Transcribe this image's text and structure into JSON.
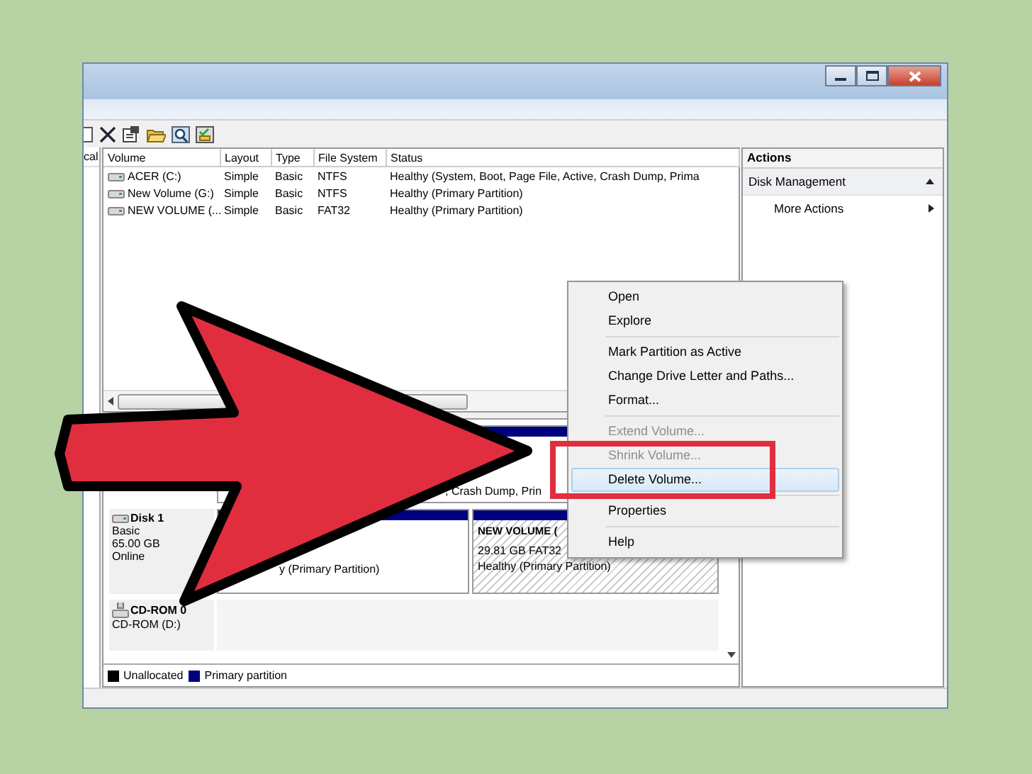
{
  "navigation_pane": {
    "header": "cal"
  },
  "volume_table": {
    "columns": [
      "Volume",
      "Layout",
      "Type",
      "File System",
      "Status"
    ],
    "rows": [
      {
        "cells": [
          "ACER (C:)",
          "Simple",
          "Basic",
          "NTFS",
          "Healthy (System, Boot, Page File, Active, Crash Dump, Prima"
        ]
      },
      {
        "cells": [
          "New Volume (G:)",
          "Simple",
          "Basic",
          "NTFS",
          "Healthy (Primary Partition)"
        ]
      },
      {
        "cells": [
          "NEW VOLUME (...",
          "Simple",
          "Basic",
          "FAT32",
          "Healthy (Primary Partition)"
        ]
      }
    ]
  },
  "disk_pane": {
    "disks": [
      {
        "kind": "covered",
        "partitions": [
          {
            "status": ", Crash Dump, Prin",
            "selected": false
          }
        ]
      },
      {
        "kind": "disk",
        "name": "Disk 1",
        "type": "Basic",
        "size": "65.00 GB",
        "state": "Online",
        "partitions": [
          {
            "status": "y (Primary Partition)",
            "selected": false
          },
          {
            "name": "NEW VOLUME (",
            "size": "29.81 GB FAT32",
            "status": "Healthy (Primary Partition)",
            "selected": true
          }
        ]
      },
      {
        "kind": "cdrom",
        "name": "CD-ROM 0",
        "drive": "CD-ROM (D:)"
      }
    ],
    "legend": [
      {
        "label": "Unallocated",
        "color": "#000000"
      },
      {
        "label": "Primary partition",
        "color": "#00007f"
      }
    ]
  },
  "actions": {
    "header": "Actions",
    "items": [
      {
        "kind": "section",
        "label": "Disk Management",
        "expanded": true
      },
      {
        "kind": "submenu",
        "label": "More Actions"
      }
    ]
  },
  "context_menu": {
    "items": [
      {
        "kind": "item",
        "label": "Open",
        "disabled": false,
        "selected": false
      },
      {
        "kind": "item",
        "label": "Explore",
        "disabled": false,
        "selected": false
      },
      {
        "kind": "separator"
      },
      {
        "kind": "item",
        "label": "Mark Partition as Active",
        "disabled": false,
        "selected": false
      },
      {
        "kind": "item",
        "label": "Change Drive Letter and Paths...",
        "disabled": false,
        "selected": false
      },
      {
        "kind": "item",
        "label": "Format...",
        "disabled": false,
        "selected": false
      },
      {
        "kind": "separator"
      },
      {
        "kind": "item",
        "label": "Extend Volume...",
        "disabled": true,
        "selected": false
      },
      {
        "kind": "item",
        "label": "Shrink Volume...",
        "disabled": true,
        "selected": false
      },
      {
        "kind": "item",
        "label": "Delete Volume...",
        "disabled": false,
        "selected": true
      },
      {
        "kind": "separator"
      },
      {
        "kind": "item",
        "label": "Properties",
        "disabled": false,
        "selected": false
      },
      {
        "kind": "separator"
      },
      {
        "kind": "item",
        "label": "Help",
        "disabled": false,
        "selected": false
      }
    ]
  }
}
